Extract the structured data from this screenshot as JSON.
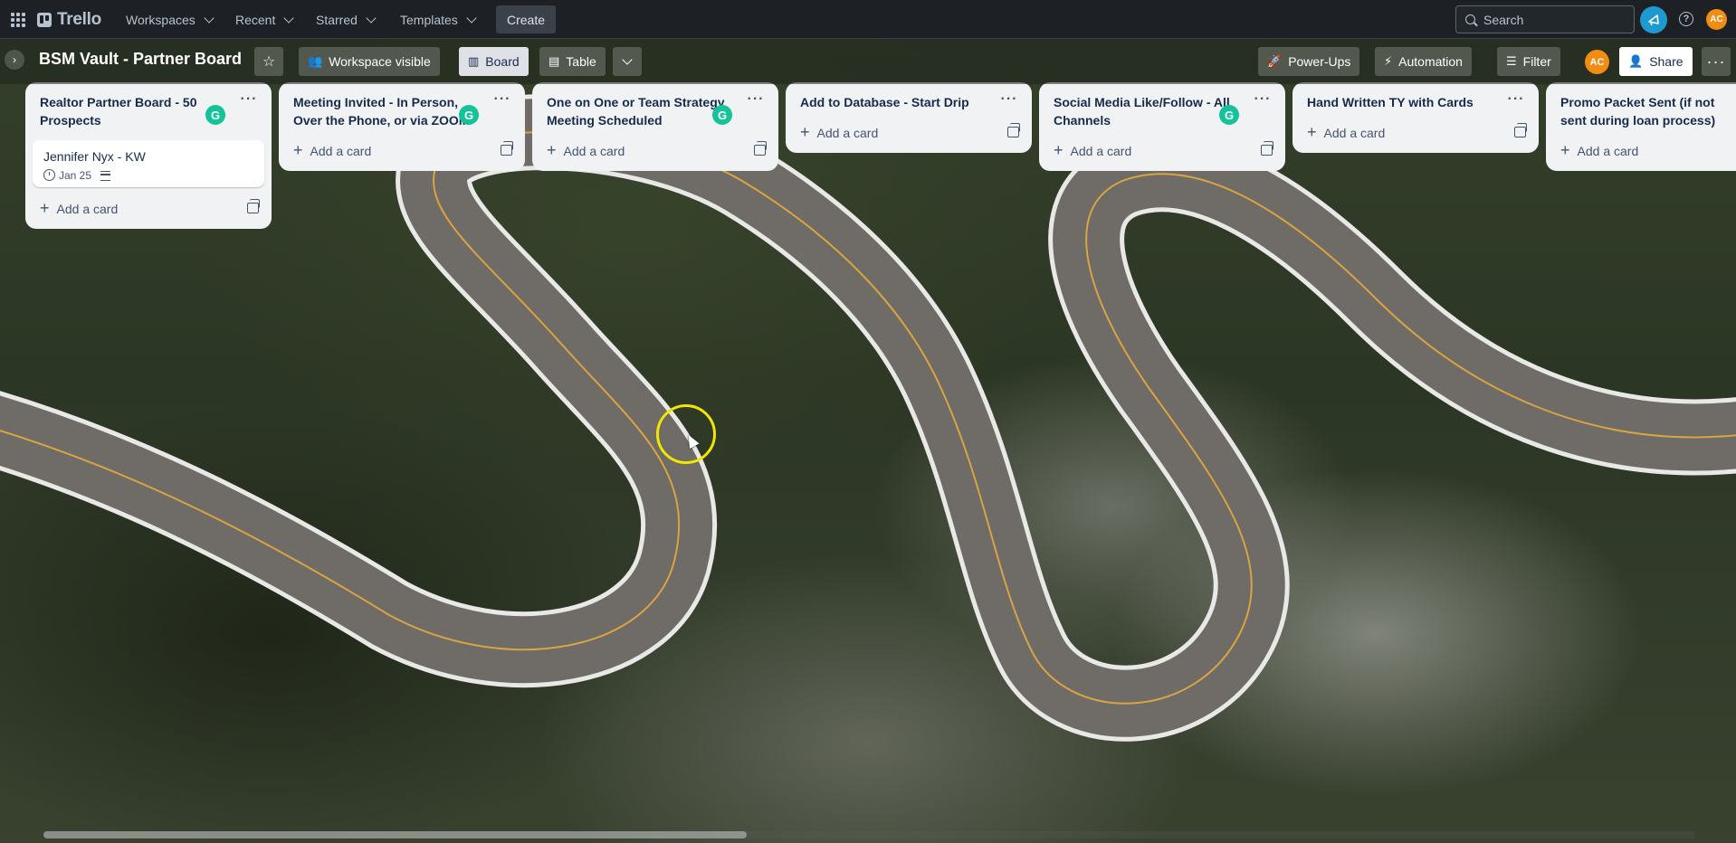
{
  "topnav": {
    "apps_icon": "apps-grid-icon",
    "logo_text": "Trello",
    "menus": [
      {
        "label": "Workspaces"
      },
      {
        "label": "Recent"
      },
      {
        "label": "Starred"
      },
      {
        "label": "Templates"
      }
    ],
    "create_label": "Create",
    "search_placeholder": "Search",
    "avatar_initials": "AC"
  },
  "board": {
    "title": "BSM Vault - Partner Board",
    "visibility_label": "Workspace visible",
    "views": [
      {
        "label": "Board"
      },
      {
        "label": "Table"
      }
    ],
    "powerups_label": "Power-Ups",
    "automation_label": "Automation",
    "filter_label": "Filter",
    "member_initials": "AC",
    "share_label": "Share"
  },
  "lists": [
    {
      "title": "Realtor Partner Board - 50 Prospects",
      "cards": [
        {
          "title": "Jennifer Nyx - KW",
          "due": "Jan 25"
        }
      ],
      "add_label": "Add a card"
    },
    {
      "title": "Meeting Invited - In Person, Over the Phone, or via ZOOM",
      "add_label": "Add a card"
    },
    {
      "title": "One on One or Team Strategy Meeting Scheduled",
      "add_label": "Add a card"
    },
    {
      "title": "Add to Database - Start Drip",
      "add_label": "Add a card"
    },
    {
      "title": "Social Media Like/Follow - All Channels",
      "add_label": "Add a card"
    },
    {
      "title": "Hand Written TY with Cards",
      "add_label": "Add a card"
    },
    {
      "title": "Promo Packet Sent (if not sent during loan process)",
      "add_label": "Add a card"
    }
  ],
  "colors": {
    "topnav_bg": "#1d2125",
    "list_bg": "#f1f2f4",
    "grammarly": "#15c39a",
    "avatar": "#f18d12",
    "notify": "#1d9bd1"
  }
}
